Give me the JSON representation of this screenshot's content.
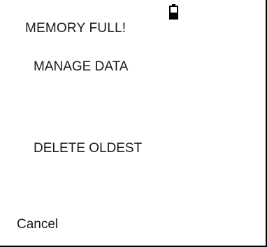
{
  "screen": {
    "title": "MEMORY FULL!",
    "battery_icon": "battery-low-icon"
  },
  "menu": {
    "items": [
      {
        "label": "MANAGE DATA"
      },
      {
        "label": "DELETE OLDEST"
      }
    ]
  },
  "softkeys": {
    "left_label": "Cancel"
  }
}
